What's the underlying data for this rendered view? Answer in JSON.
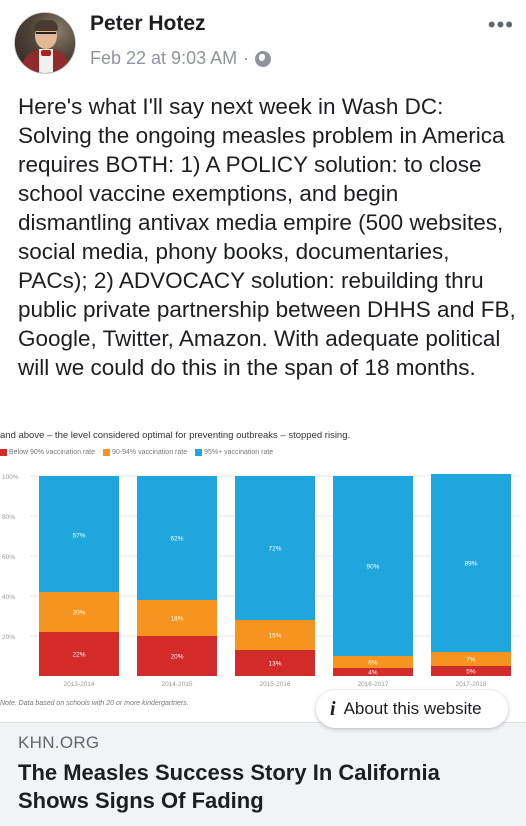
{
  "post": {
    "author": "Peter Hotez",
    "timestamp": "Feb 22 at 9:03 AM",
    "separator": "·",
    "privacy_icon": "globe-icon",
    "more_icon": "more-options-icon",
    "more_label": "•••",
    "text": "Here's what I'll say next week in Wash DC:\nSolving the ongoing measles problem in America requires BOTH: 1) A POLICY solution: to close school vaccine exemptions, and begin dismantling antivax media empire (500 websites, social media, phony books, documentaries, PACs); 2) ADVOCACY solution: rebuilding thru public private partnership between DHHS and FB, Google, Twitter, Amazon.  With adequate political will we could do this in the span of 18 months."
  },
  "chart_caption": "and above – the level considered optimal for preventing outbreaks – stopped rising.",
  "note": "Note: Data based on schools with 20 or more kindergartners.",
  "colors": {
    "below90": "#d32a2a",
    "mid": "#f5941e",
    "above95": "#1ea6dd"
  },
  "chart_data": {
    "type": "bar",
    "stacked": true,
    "categories": [
      "2013-2014",
      "2014-2015",
      "2015-2016",
      "2016-2017",
      "2017-2018"
    ],
    "series": [
      {
        "name": "Below 90% vaccination rate",
        "values": [
          22,
          20,
          13,
          4,
          5
        ],
        "labels": [
          "22%",
          "20%",
          "13%",
          "4%",
          "5%"
        ]
      },
      {
        "name": "90-94% vaccination rate",
        "values": [
          20,
          18,
          15,
          6,
          7
        ],
        "labels": [
          "20%",
          "18%",
          "15%",
          "6%",
          "7%"
        ]
      },
      {
        "name": "95%+ vaccination rate",
        "values": [
          57,
          62,
          72,
          90,
          89
        ],
        "labels": [
          "57%",
          "62%",
          "72%",
          "90%",
          "89%"
        ]
      }
    ],
    "yticks": [
      "100%",
      "80%",
      "60%",
      "40%",
      "20%"
    ],
    "ylim": [
      0,
      100
    ],
    "legend": "top-left",
    "grid": true
  },
  "link": {
    "domain": "KHN.ORG",
    "headline": "The Measles Success Story In California Shows Signs Of Fading",
    "about_label": "About this website",
    "about_icon": "info-icon",
    "about_icon_glyph": "i"
  }
}
